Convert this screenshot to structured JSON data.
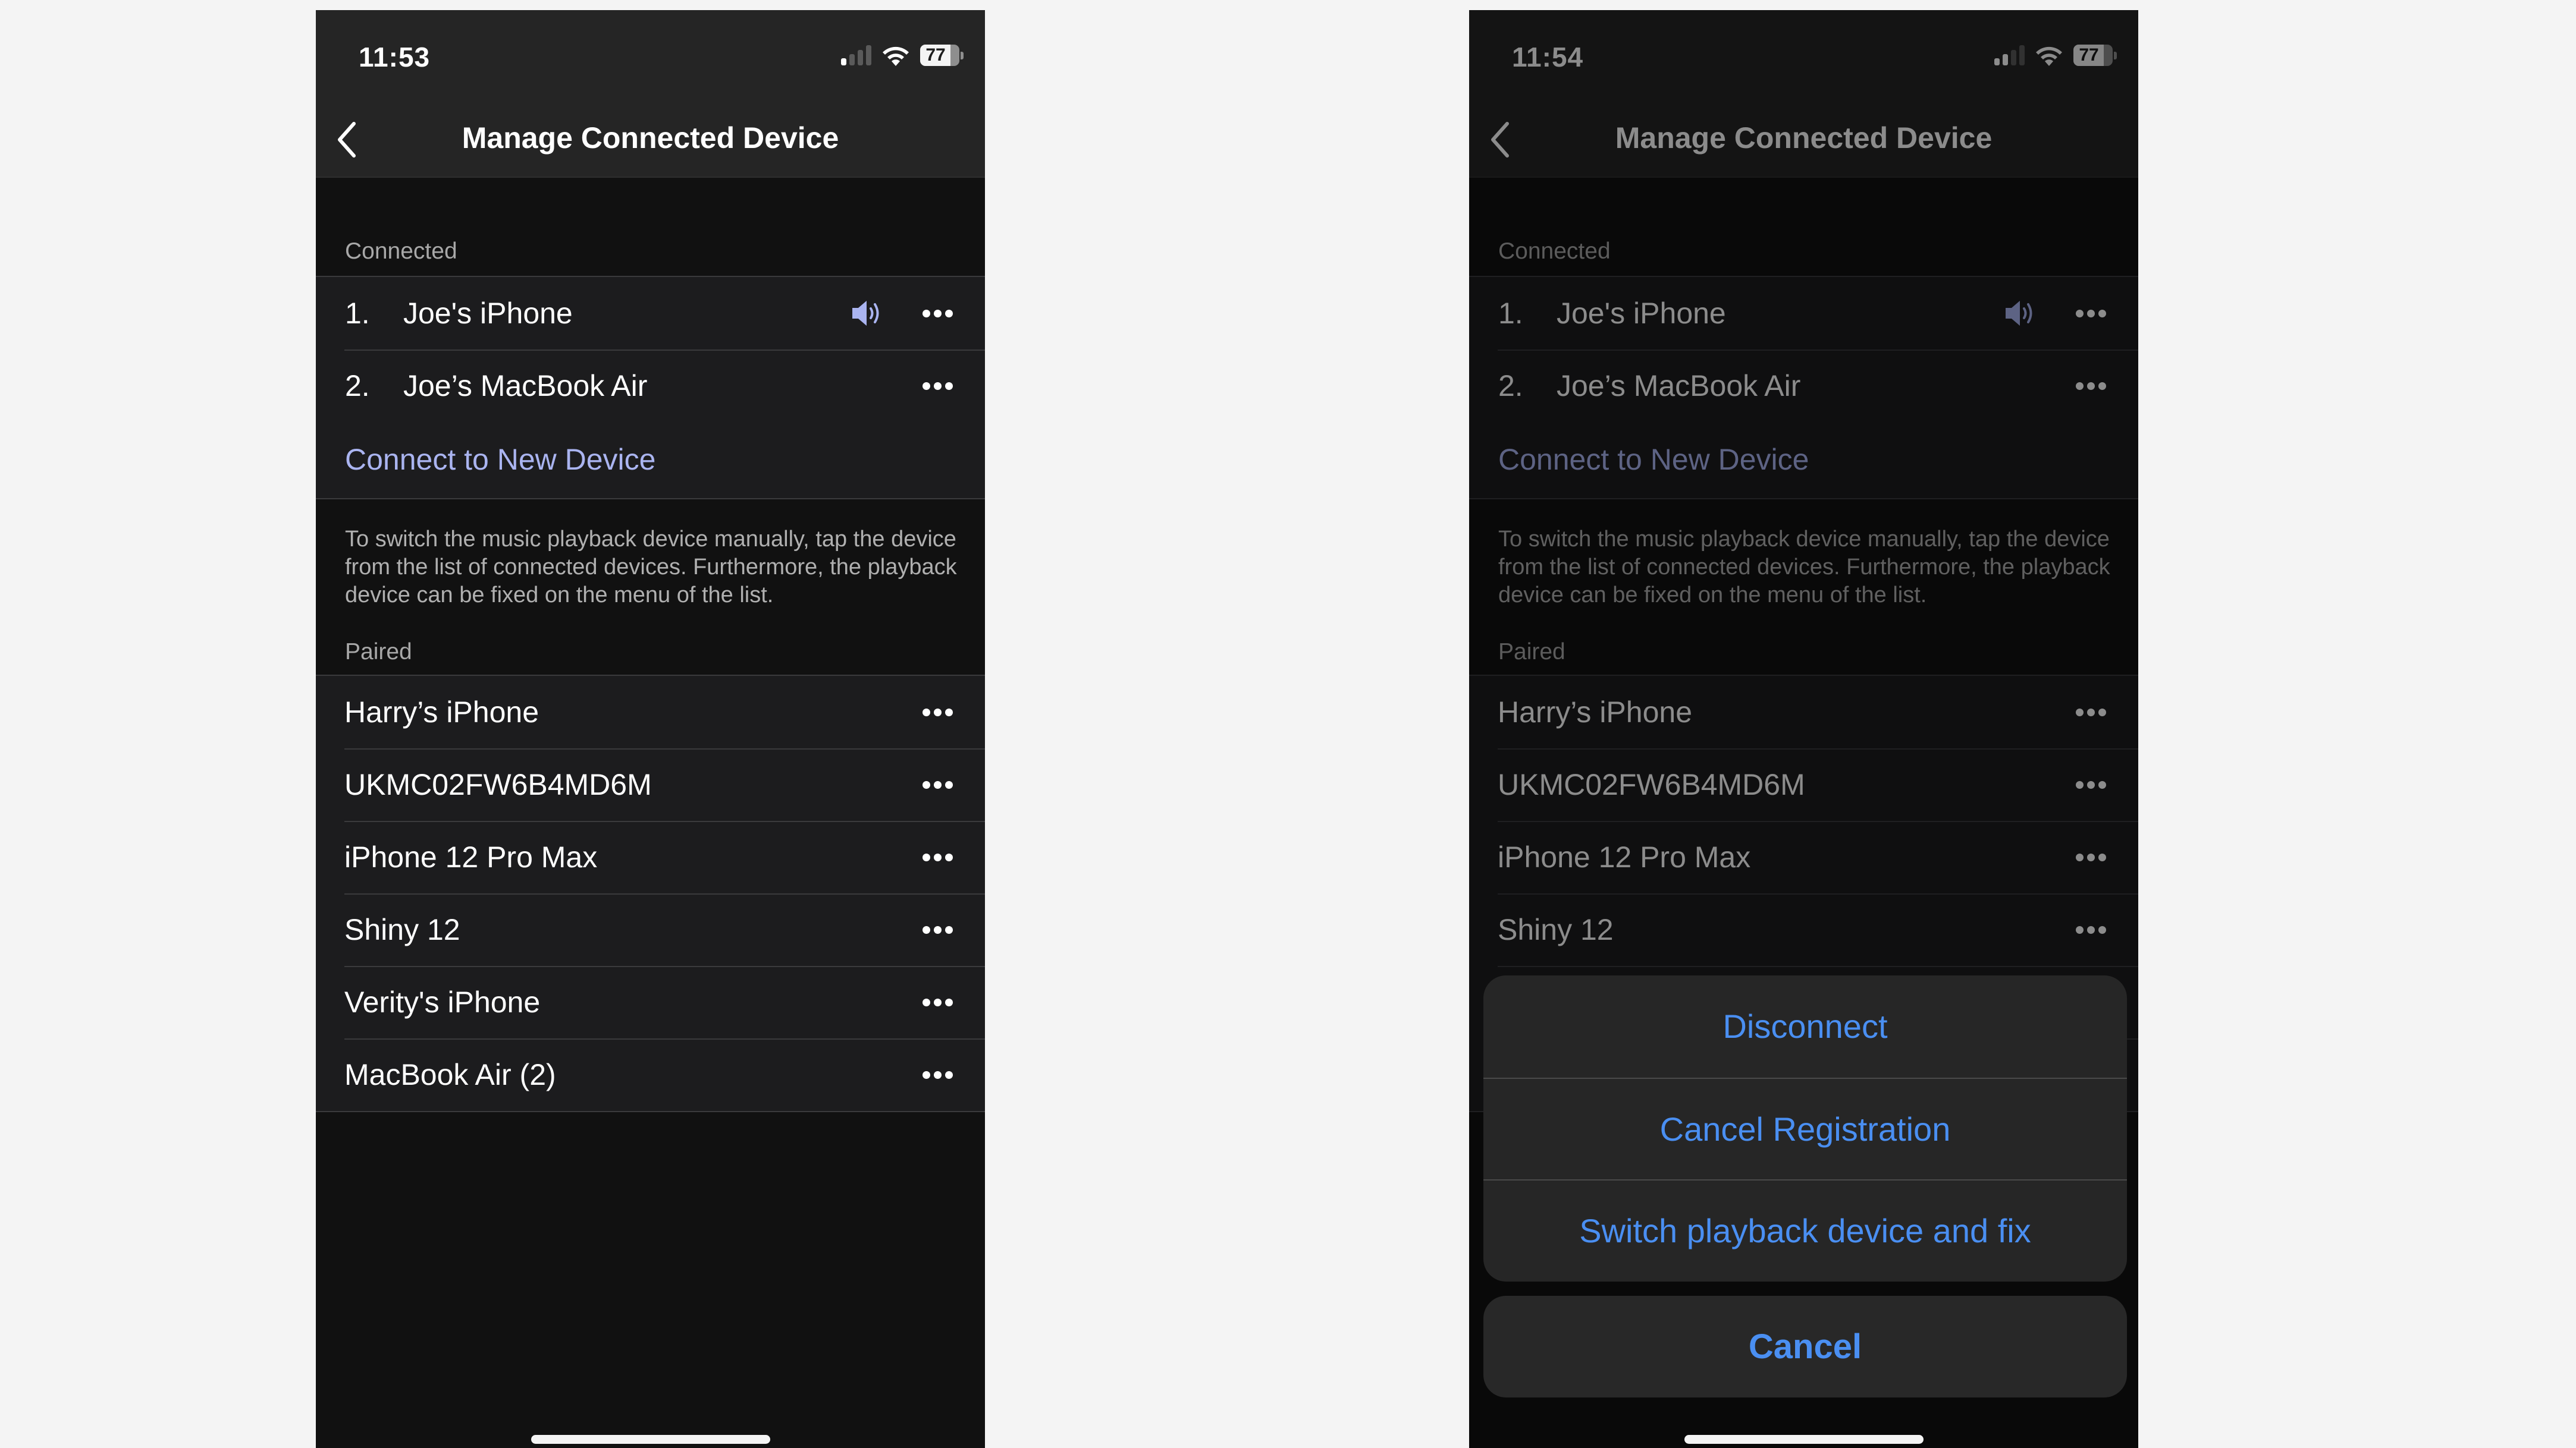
{
  "colors": {
    "background": "#f4f4f4",
    "screen": "#111111",
    "topbar": "#252525",
    "row": "#1c1c1e",
    "link": "#aab4f0",
    "speaker": "#aab4f0",
    "action": "#4a8ff2"
  },
  "screens": [
    {
      "status": {
        "time": "11:53",
        "signal_bars": 1,
        "signal_total": 4,
        "battery_percent": 77,
        "battery_label": "77"
      },
      "nav": {
        "back_icon": "chevron-left-icon",
        "title": "Manage Connected Device"
      },
      "connected": {
        "label": "Connected",
        "items": [
          {
            "num": "1.",
            "name": "Joe's iPhone",
            "playing": true
          },
          {
            "num": "2.",
            "name": "Joe’s MacBook Air",
            "playing": false
          }
        ],
        "connect_new": "Connect to New Device"
      },
      "description": "To switch the music playback device manually, tap the device from the list of connected devices. Furthermore, the playback device can be fixed on the menu of the list.",
      "paired": {
        "label": "Paired",
        "items": [
          "Harry’s iPhone",
          "UKMC02FW6B4MD6M",
          "iPhone 12 Pro Max",
          "Shiny 12",
          "Verity's iPhone",
          "MacBook Air (2)"
        ]
      }
    },
    {
      "status": {
        "time": "11:54",
        "signal_bars": 2,
        "signal_total": 4,
        "battery_percent": 77,
        "battery_label": "77"
      },
      "nav": {
        "back_icon": "chevron-left-icon",
        "title": "Manage Connected Device"
      },
      "connected": {
        "label": "Connected",
        "items": [
          {
            "num": "1.",
            "name": "Joe's iPhone",
            "playing": true
          },
          {
            "num": "2.",
            "name": "Joe’s MacBook Air",
            "playing": false
          }
        ],
        "connect_new": "Connect to New Device"
      },
      "description": "To switch the music playback device manually, tap the device from the list of connected devices. Furthermore, the playback device can be fixed on the menu of the list.",
      "paired": {
        "label": "Paired",
        "items": [
          "Harry’s iPhone",
          "UKMC02FW6B4MD6M",
          "iPhone 12 Pro Max",
          "Shiny 12",
          "Verity's iPhone",
          "MacBook Air (2)"
        ]
      },
      "action_sheet": {
        "actions": [
          "Disconnect",
          "Cancel Registration",
          "Switch playback device and fix"
        ],
        "cancel": "Cancel"
      }
    }
  ]
}
